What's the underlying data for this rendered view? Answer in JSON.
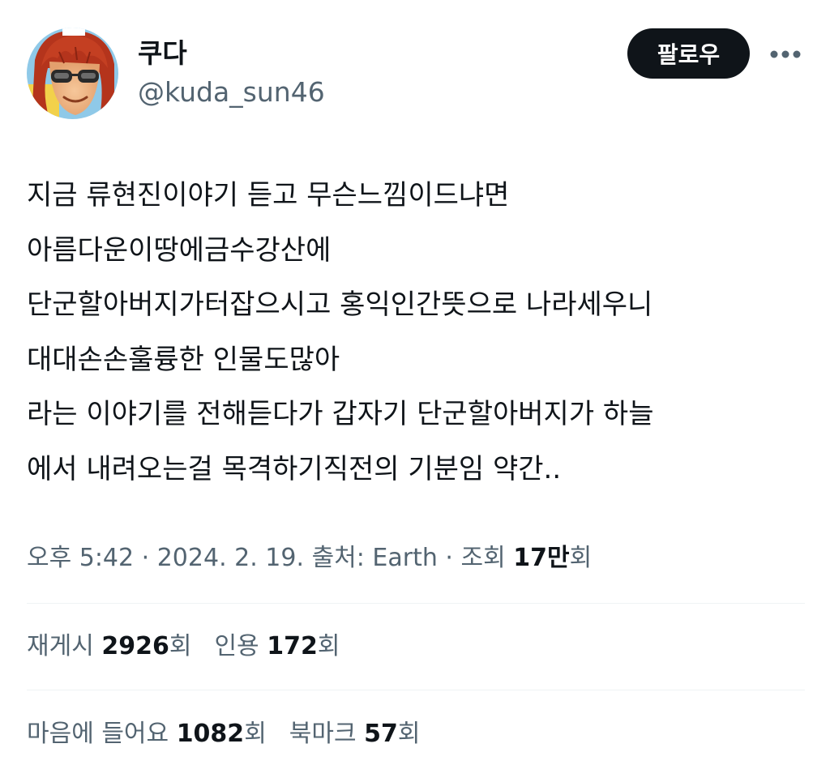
{
  "author": {
    "display_name": "쿠다",
    "handle": "@kuda_sun46"
  },
  "actions": {
    "follow_label": "팔로우",
    "more_icon": "more-horizontal-icon"
  },
  "tweet": {
    "lines": [
      "지금 류현진이야기 듣고 무슨느낌이드냐면",
      "아름다운이땅에금수강산에",
      "단군할아버지가터잡으시고 홍익인간뜻으로 나라세우니",
      "대대손손훌륭한 인물도많아",
      "라는 이야기를 전해듣다가 갑자기 단군할아버지가 하늘",
      "에서 내려오는걸 목격하기직전의 기분임 약간.."
    ]
  },
  "meta": {
    "time": "오후 5:42",
    "separator": " · ",
    "date": "2024. 2. 19.",
    "source_label": "출처: ",
    "source": "Earth",
    "views_label": "조회 ",
    "views_value": "17만",
    "views_suffix": "회"
  },
  "stats": {
    "reposts": {
      "label": "재게시 ",
      "value": "2926",
      "suffix": "회"
    },
    "quotes": {
      "label": "인용 ",
      "value": "172",
      "suffix": "회"
    },
    "likes": {
      "label": "마음에 들어요 ",
      "value": "1082",
      "suffix": "회"
    },
    "bookmarks": {
      "label": "북마크 ",
      "value": "57",
      "suffix": "회"
    }
  },
  "colors": {
    "text_primary": "#0f1419",
    "text_secondary": "#536471",
    "divider": "#eff3f4",
    "follow_bg": "#0f1419",
    "follow_text": "#ffffff"
  }
}
